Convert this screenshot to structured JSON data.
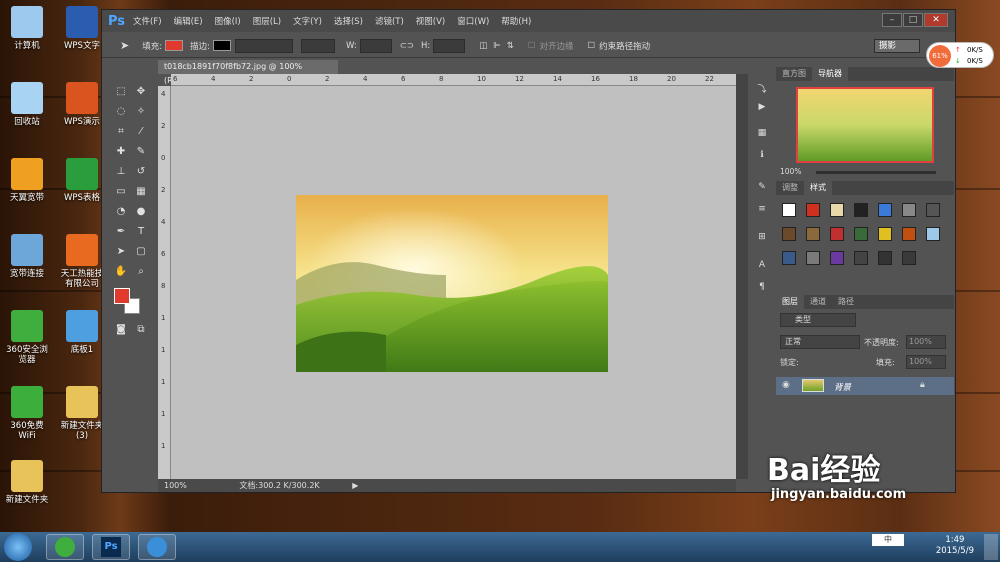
{
  "desktop": {
    "icons": [
      {
        "label": "计算机",
        "icon": "computer-icon",
        "color": "#9ec9ef"
      },
      {
        "label": "WPS文字",
        "icon": "wps-writer-icon",
        "color": "#2a5db0"
      },
      {
        "label": "回收站",
        "icon": "recycle-bin-icon",
        "color": "#a9d3f2"
      },
      {
        "label": "WPS演示",
        "icon": "wps-presentation-icon",
        "color": "#d9541e"
      },
      {
        "label": "天翼宽带",
        "icon": "tianyi-broadband-icon",
        "color": "#f0a020"
      },
      {
        "label": "WPS表格",
        "icon": "wps-spreadsheet-icon",
        "color": "#2a9d3c"
      },
      {
        "label": "宽带连接",
        "icon": "broadband-connection-icon",
        "color": "#6da6d8"
      },
      {
        "label": "天工热能技有限公司",
        "icon": "document-icon",
        "color": "#e86a20"
      },
      {
        "label": "360安全浏览器",
        "icon": "360-browser-icon",
        "color": "#3fae3f"
      },
      {
        "label": "底板1",
        "icon": "image-file-icon",
        "color": "#4d9fe0"
      },
      {
        "label": "360免费WiFi",
        "icon": "360-wifi-icon",
        "color": "#3cae3c"
      },
      {
        "label": "新建文件夹(3)",
        "icon": "folder-icon",
        "color": "#e8c35a"
      },
      {
        "label": "新建文件夹",
        "icon": "folder-icon",
        "color": "#e8c35a"
      }
    ]
  },
  "photoshop": {
    "logo": "Ps",
    "menus": [
      "文件(F)",
      "编辑(E)",
      "图像(I)",
      "图层(L)",
      "文字(Y)",
      "选择(S)",
      "滤镜(T)",
      "视图(V)",
      "窗口(W)",
      "帮助(H)"
    ],
    "options": {
      "fill_label": "填充:",
      "stroke_label": "描边:",
      "fill_color": "#e03a2c",
      "stroke_color": "#000000",
      "w_label": "W:",
      "h_label": "H:",
      "align_edges": "对齐边缘",
      "constrain_path": "约束路径拖动",
      "workspace": "摄影"
    },
    "document": {
      "tab_title": "t018cb1891f70f8fb72.jpg @ 100%(RGB/8#)",
      "zoom": "100%",
      "doc_info": "文档:300.2 K/300.2K"
    },
    "ruler_h_ticks": [
      "6",
      "4",
      "2",
      "0",
      "2",
      "4",
      "6",
      "8",
      "10",
      "12",
      "14",
      "16",
      "18",
      "20",
      "22"
    ],
    "ruler_v_ticks": [
      "4",
      "2",
      "0",
      "2",
      "4",
      "6",
      "8",
      "1",
      "1",
      "1",
      "1",
      "1"
    ],
    "foreground_color": "#e03a2c",
    "background_color": "#ffffff",
    "navigator": {
      "tabs": [
        "直方图",
        "导航器"
      ],
      "zoom": "100%"
    },
    "styles_panel": {
      "tabs": [
        "调整",
        "样式"
      ]
    },
    "layers": {
      "tabs": [
        "图层",
        "通道",
        "路径"
      ],
      "kind": "类型",
      "blend_mode": "正常",
      "opacity_label": "不透明度:",
      "opacity": "100%",
      "lock_label": "锁定:",
      "fill_label": "填充:",
      "fill": "100%",
      "layer_name": "背景"
    }
  },
  "network_widget": {
    "percent": "61%",
    "up": "0K/S",
    "down": "0K/S"
  },
  "watermark": {
    "brand": "Bai经验",
    "url": "jingyan.baidu.com"
  },
  "taskbar": {
    "time": "1:49",
    "date": "2015/5/9",
    "ime": "中"
  }
}
